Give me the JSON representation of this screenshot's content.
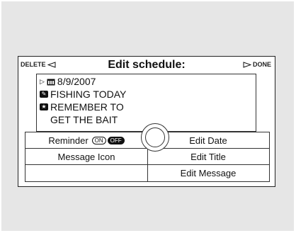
{
  "header": {
    "delete_label": "DELETE",
    "title": "Edit schedule:",
    "done_label": "DONE"
  },
  "detail": {
    "date": "8/9/2007",
    "line1": "FISHING TODAY",
    "line2": "REMEMBER TO",
    "line3": "GET THE BAIT"
  },
  "menu": {
    "reminder_label": "Reminder",
    "reminder_on": "ON",
    "reminder_off": "OFF",
    "reminder_state": "off",
    "message_icon_label": "Message Icon",
    "edit_date_label": "Edit Date",
    "edit_title_label": "Edit Title",
    "edit_message_label": "Edit Message"
  },
  "icons": {
    "delete": "left-triangle-icon",
    "done": "right-triangle-icon",
    "date": "calendar-icon",
    "line1": "message-icon",
    "line2": "star-icon",
    "pointer": "right-pointer-icon",
    "knob": "interface-dial-icon"
  }
}
